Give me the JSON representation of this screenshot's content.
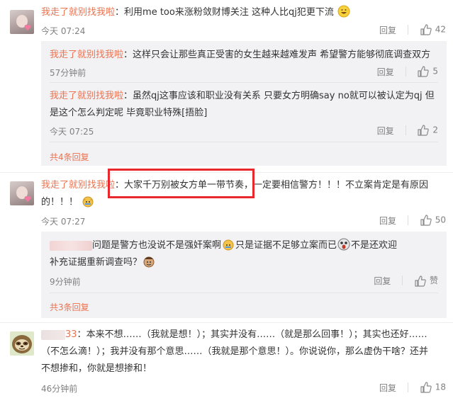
{
  "comments": [
    {
      "username": "我走了就别找我啦",
      "colon": "：",
      "text": "利用me too来涨粉敛财博关注 这种人比qj犯更下流",
      "time": "今天 07:24",
      "reply_label": "回复",
      "likes": "42",
      "replies": [
        {
          "username": "我走了就别找我啦",
          "colon": "：",
          "text": "这样只会让那些真正受害的女生越来越难发声 希望警方能够彻底调查双方",
          "time": "57分钟前",
          "reply_label": "回复",
          "likes": "5"
        },
        {
          "username": "我走了就别找我啦",
          "colon": "：",
          "text_line1": "虽然qj这事应该和职业没有关系 只要女方明确say no就可以被认定为qj 但",
          "text_line2": "是这个怎么判定呢 毕竟职业特殊[捂脸]",
          "time": "今天 07:25",
          "reply_label": "回复",
          "likes": "2"
        }
      ],
      "more_replies": "共4条回复"
    },
    {
      "username": "我走了就别找我啦",
      "colon": "：",
      "text_part1": "大家千万别被女方单一带节奏，",
      "text_part2": "一定要相信警方！！！不立案肯定是有原因",
      "text_line2": "的！！！",
      "time": "今天 07:27",
      "reply_label": "回复",
      "likes": "50",
      "replies": [
        {
          "text_line1a": "问题是警方也没说不是强奸案啊",
          "text_line1b": "只是证据不足够立案而已",
          "text_line1c": "不是还欢迎",
          "text_line2": "补充证据重新调查吗？",
          "time": "9分钟前",
          "reply_label": "回复",
          "likes": "赞"
        }
      ],
      "more_replies": "共3条回复"
    },
    {
      "username_suffix": "33",
      "colon": "：",
      "text_line1": "本来不想……（我就是想！）；其实并没有……（就是那么回事！）；其实也还好……",
      "text_line2": "（不怎么滴！）；我并没有那个意思……（我就是那个意思！）。你说说你，那么虚伪干啥？还并",
      "text_line3": "不想掺和，你就是想掺和！",
      "time": "46分钟前",
      "reply_label": "回复",
      "likes": "18"
    }
  ],
  "colors": {
    "username": "#eb7350",
    "highlight": "#e8282c",
    "reply_bg": "#f2f2f5",
    "meta": "#808080"
  },
  "icons": [
    "thumbs-up-icon",
    "heart-icon",
    "grin-emoji",
    "doge-emoji",
    "scream-emoji",
    "sloth-avatar"
  ]
}
